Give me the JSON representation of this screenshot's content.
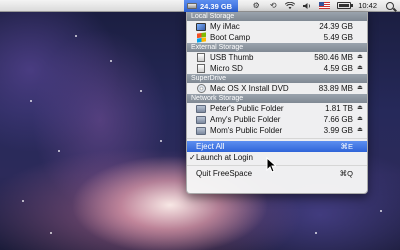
{
  "menubar": {
    "freespace_value": "24.39 GB",
    "clock": "10:42",
    "icons": [
      "gear-icon",
      "time-machine-icon",
      "wifi-icon",
      "volume-icon",
      "us-flag-icon",
      "battery-icon",
      "spotlight-icon"
    ]
  },
  "menu": {
    "sections": [
      {
        "header": "Local Storage",
        "items": [
          {
            "icon": "imac-icon",
            "name": "My iMac",
            "size": "24.39 GB",
            "eject": ""
          },
          {
            "icon": "bootcamp-icon",
            "name": "Boot Camp",
            "size": "5.49 GB",
            "eject": ""
          }
        ]
      },
      {
        "header": "External Storage",
        "items": [
          {
            "icon": "usb-drive-icon",
            "name": "USB Thumb",
            "size": "580.46 MB",
            "eject": "⏏"
          },
          {
            "icon": "sd-card-icon",
            "name": "Micro SD",
            "size": "4.59 GB",
            "eject": "⏏"
          }
        ]
      },
      {
        "header": "SuperDrive",
        "items": [
          {
            "icon": "dvd-icon",
            "name": "Mac OS X Install DVD",
            "size": "83.89 MB",
            "eject": "⏏"
          }
        ]
      },
      {
        "header": "Network Storage",
        "items": [
          {
            "icon": "network-folder-icon",
            "name": "Peter's Public Folder",
            "size": "1.81 TB",
            "eject": "⏏"
          },
          {
            "icon": "network-folder-icon",
            "name": "Amy's Public Folder",
            "size": "7.66 GB",
            "eject": "⏏"
          },
          {
            "icon": "network-folder-icon",
            "name": "Mom's Public Folder",
            "size": "3.99 GB",
            "eject": "⏏"
          }
        ]
      }
    ],
    "eject_all": {
      "label": "Eject All",
      "shortcut": "⌘E"
    },
    "launch_at_login": {
      "label": "Launch at Login",
      "checked": "✓"
    },
    "quit": {
      "label": "Quit FreeSpace",
      "shortcut": "⌘Q"
    },
    "colors": {
      "highlight": "#2f64d8",
      "section_header": "#8a939d"
    }
  }
}
